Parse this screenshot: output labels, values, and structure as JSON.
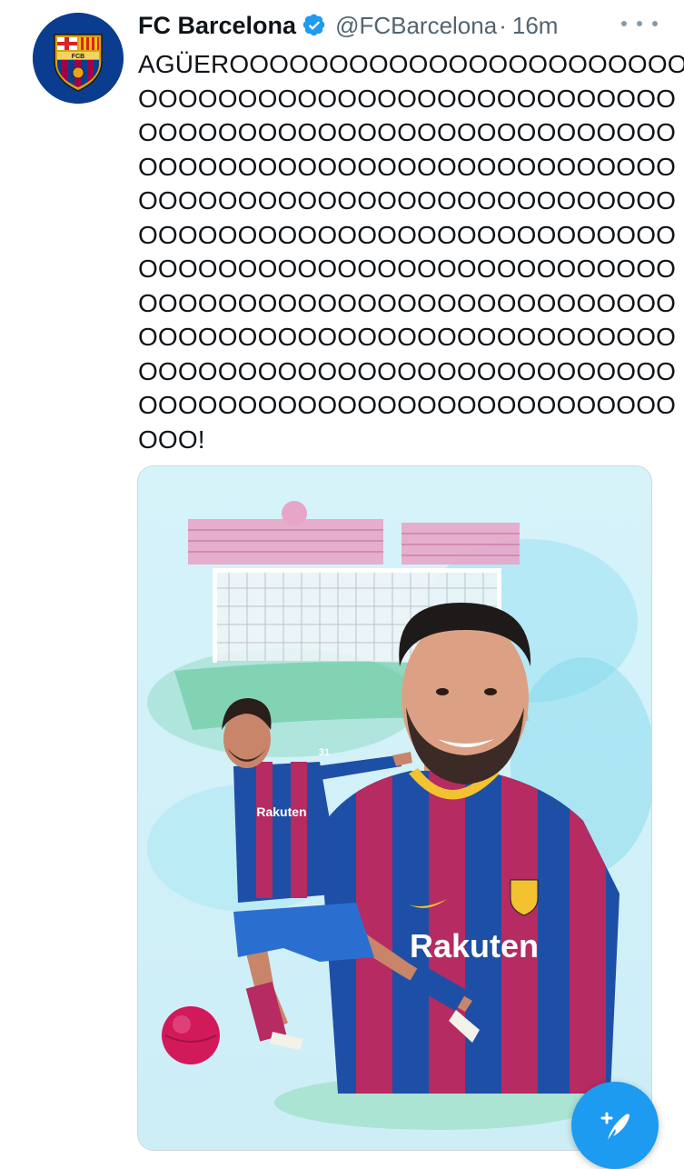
{
  "tweet": {
    "author_name": "FC Barcelona",
    "handle": "@FCBarcelona",
    "separator": "·",
    "time": "16m",
    "text_lines": [
      "AGÜEROOOOOOOOOOOOOOOOOOOOOOO",
      "OOOOOOOOOOOOOOOOOOOOOOOOOOO",
      "OOOOOOOOOOOOOOOOOOOOOOOOOOO",
      "OOOOOOOOOOOOOOOOOOOOOOOOOOO",
      "OOOOOOOOOOOOOOOOOOOOOOOOOOO",
      "OOOOOOOOOOOOOOOOOOOOOOOOOOO",
      "OOOOOOOOOOOOOOOOOOOOOOOOOOO",
      "OOOOOOOOOOOOOOOOOOOOOOOOOOO",
      "OOOOOOOOOOOOOOOOOOOOOOOOOOO",
      "OOOOOOOOOOOOOOOOOOOOOOOOOOO",
      "OOOOOOOOOOOOOOOOOOOOOOOOOOO",
      "OOO!"
    ]
  },
  "avatar": {
    "crest_text": "FCB"
  },
  "media": {
    "jersey_sponsor": "Rakuten",
    "shirt_number": "31"
  },
  "icons": {
    "verified": "verified-badge-icon",
    "more": "more-options-icon",
    "compose": "compose-tweet-icon"
  },
  "colors": {
    "accent_blue": "#1d9bf0",
    "text_primary": "#0f1419",
    "text_secondary": "#536471",
    "barca_blue": "#0a3d8f",
    "barca_red": "#c2185b"
  }
}
